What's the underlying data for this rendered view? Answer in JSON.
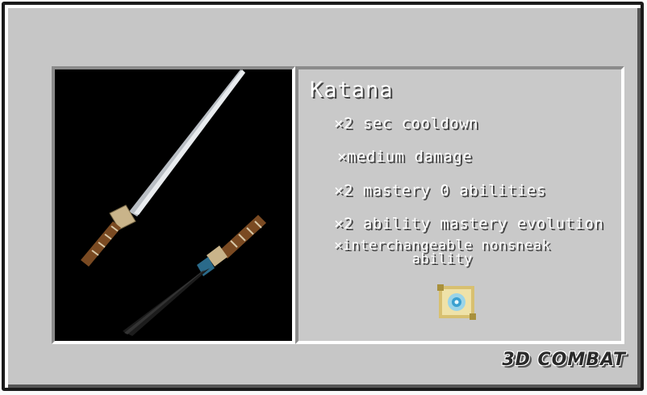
{
  "item": {
    "name": "Katana",
    "stats": [
      "×2 sec cooldown",
      "×medium damage",
      "×2 mastery 0 abilities",
      "×2 ability mastery evolution"
    ],
    "stat_last_line1": "×interchangeable nonsneak",
    "stat_last_line2": "ability",
    "image_icon": "katana-and-sheath-icon",
    "ability_icon": "ability-scroll-icon"
  },
  "brand": "3D COMBAT",
  "colors": {
    "panel_bg": "#c6c6c6",
    "image_bg": "#000000",
    "text": "#ffffff",
    "text_shadow": "#3f3f3f"
  }
}
